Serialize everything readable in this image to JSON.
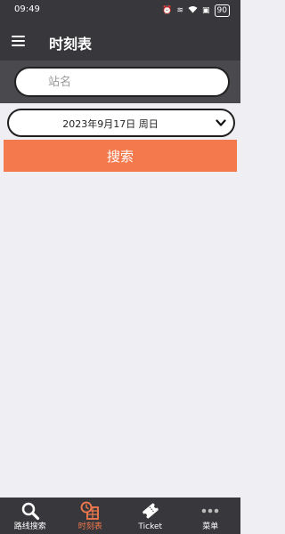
{
  "status_bar": {
    "time": "09:49",
    "icons": [
      "alarm-icon",
      "vibrate-icon",
      "wifi-icon",
      "sim-icon"
    ],
    "battery": "90"
  },
  "app_bar": {
    "title": "时刻表",
    "menu_icon": "hamburger-menu-icon"
  },
  "station_search": {
    "placeholder": "站名",
    "value": ""
  },
  "date_selector": {
    "value": "2023年9月17日 周日",
    "icon": "chevron-down-icon"
  },
  "search_button": {
    "label": "搜索"
  },
  "bottom_nav": {
    "items": [
      {
        "label": "路线搜索",
        "icon": "search-icon",
        "active": false
      },
      {
        "label": "时刻表",
        "icon": "timetable-icon",
        "active": true
      },
      {
        "label": "Ticket",
        "icon": "ticket-icon",
        "active": false
      },
      {
        "label": "菜单",
        "icon": "more-icon",
        "active": false
      }
    ]
  },
  "colors": {
    "header_bg": "#38383c",
    "accent": "#f47a4d",
    "page_bg": "#efeef3"
  }
}
